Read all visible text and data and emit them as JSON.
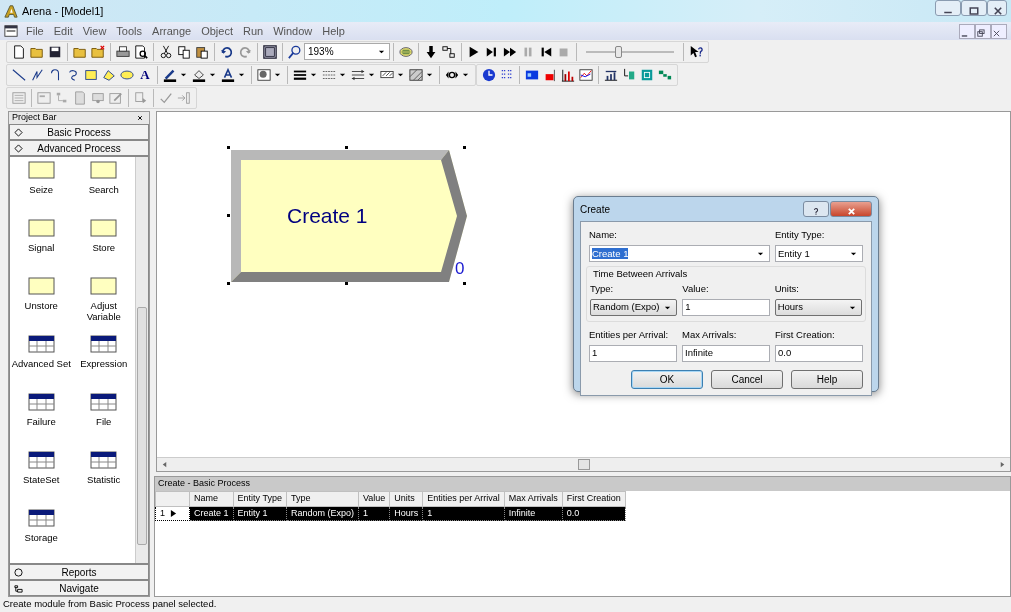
{
  "window": {
    "title": "Arena - [Model1]"
  },
  "menu": [
    "File",
    "Edit",
    "View",
    "Tools",
    "Arrange",
    "Object",
    "Run",
    "Window",
    "Help"
  ],
  "toolbar": {
    "zoom": "193%",
    "speed_slider": {
      "level": 0.36
    },
    "text_tool": "A"
  },
  "project_bar": {
    "title": "Project Bar",
    "panels": [
      "Basic Process",
      "Advanced Process"
    ],
    "modules": [
      {
        "label": "Seize",
        "kind": "flowchart"
      },
      {
        "label": "Search",
        "kind": "flowchart"
      },
      {
        "label": "Signal",
        "kind": "flowchart"
      },
      {
        "label": "Store",
        "kind": "flowchart"
      },
      {
        "label": "Unstore",
        "kind": "flowchart"
      },
      {
        "label": "Adjust Variable",
        "kind": "flowchart"
      },
      {
        "label": "Advanced Set",
        "kind": "data"
      },
      {
        "label": "Expression",
        "kind": "data"
      },
      {
        "label": "Failure",
        "kind": "data"
      },
      {
        "label": "File",
        "kind": "data"
      },
      {
        "label": "StateSet",
        "kind": "data"
      },
      {
        "label": "Statistic",
        "kind": "data"
      },
      {
        "label": "Storage",
        "kind": "data"
      }
    ],
    "bottom_panels": [
      "Reports",
      "Navigate"
    ]
  },
  "canvas": {
    "module": {
      "label": "Create 1",
      "count": "0",
      "selected": true
    }
  },
  "dialog": {
    "title": "Create",
    "rows": [
      {
        "fields": [
          {
            "label": "Name:",
            "value": "Create 1",
            "kind": "combo",
            "highlighted": true
          },
          {
            "label": "Entity Type:",
            "value": "Entity 1",
            "kind": "combo",
            "highlighted": false
          }
        ]
      },
      {
        "group": "Time Between Arrivals",
        "fields": [
          {
            "label": "Type:",
            "value": "Random (Expo)",
            "kind": "dropdown",
            "highlighted": false
          },
          {
            "label": "Value:",
            "value": "1",
            "kind": "text",
            "highlighted": false
          },
          {
            "label": "Units:",
            "value": "Hours",
            "kind": "dropdown",
            "highlighted": false
          }
        ]
      },
      {
        "fields": [
          {
            "label": "Entities per Arrival:",
            "value": "1",
            "kind": "text",
            "highlighted": false
          },
          {
            "label": "Max Arrivals:",
            "value": "Infinite",
            "kind": "text",
            "highlighted": false
          },
          {
            "label": "First Creation:",
            "value": "0.0",
            "kind": "text",
            "highlighted": false
          }
        ]
      }
    ],
    "buttons": [
      {
        "label": "OK",
        "default": true
      },
      {
        "label": "Cancel",
        "default": false
      },
      {
        "label": "Help",
        "default": false
      }
    ]
  },
  "spreadsheet": {
    "title": "Create - Basic Process",
    "columns": [
      "Name",
      "Entity Type",
      "Type",
      "Value",
      "Units",
      "Entities per Arrival",
      "Max Arrivals",
      "First Creation"
    ],
    "rows": [
      {
        "number": "1",
        "selected": true,
        "cells": [
          "Create 1",
          "Entity 1",
          "Random (Expo)",
          "1",
          "Hours",
          "1",
          "Infinite",
          "0.0"
        ]
      }
    ]
  },
  "status_bar": "Create module from Basic Process panel selected."
}
